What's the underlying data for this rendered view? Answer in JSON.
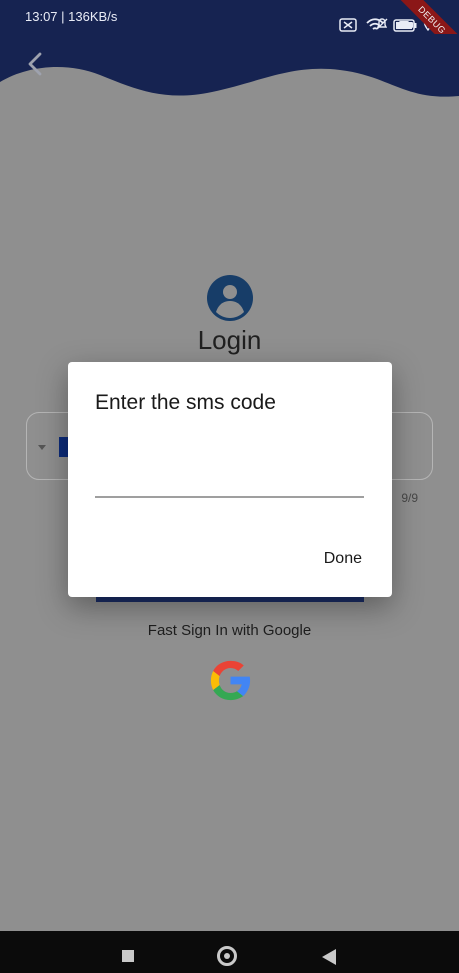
{
  "status_bar": {
    "time": "13:07",
    "network_speed": "136KB/s",
    "icons": [
      "notifications-off-icon",
      "camera-icon",
      "location-icon",
      "no-sim-icon",
      "wifi-icon",
      "battery-icon"
    ]
  },
  "debug_banner": "DEBUG",
  "header": {
    "back_icon": "back-chevron-icon"
  },
  "login": {
    "title": "Login",
    "avatar_icon": "account-circle-icon"
  },
  "phone_field": {
    "counter": "9/9"
  },
  "google_sign_in": {
    "label": "Fast Sign In with Google",
    "icon": "google-logo-icon"
  },
  "dialog": {
    "title": "Enter the sms code",
    "input_value": "",
    "done_label": "Done"
  },
  "colors": {
    "primary": "#162351",
    "scrim": "#8f8f8f",
    "dialog_background": "#ffffff",
    "text": "#1a1a1a"
  }
}
